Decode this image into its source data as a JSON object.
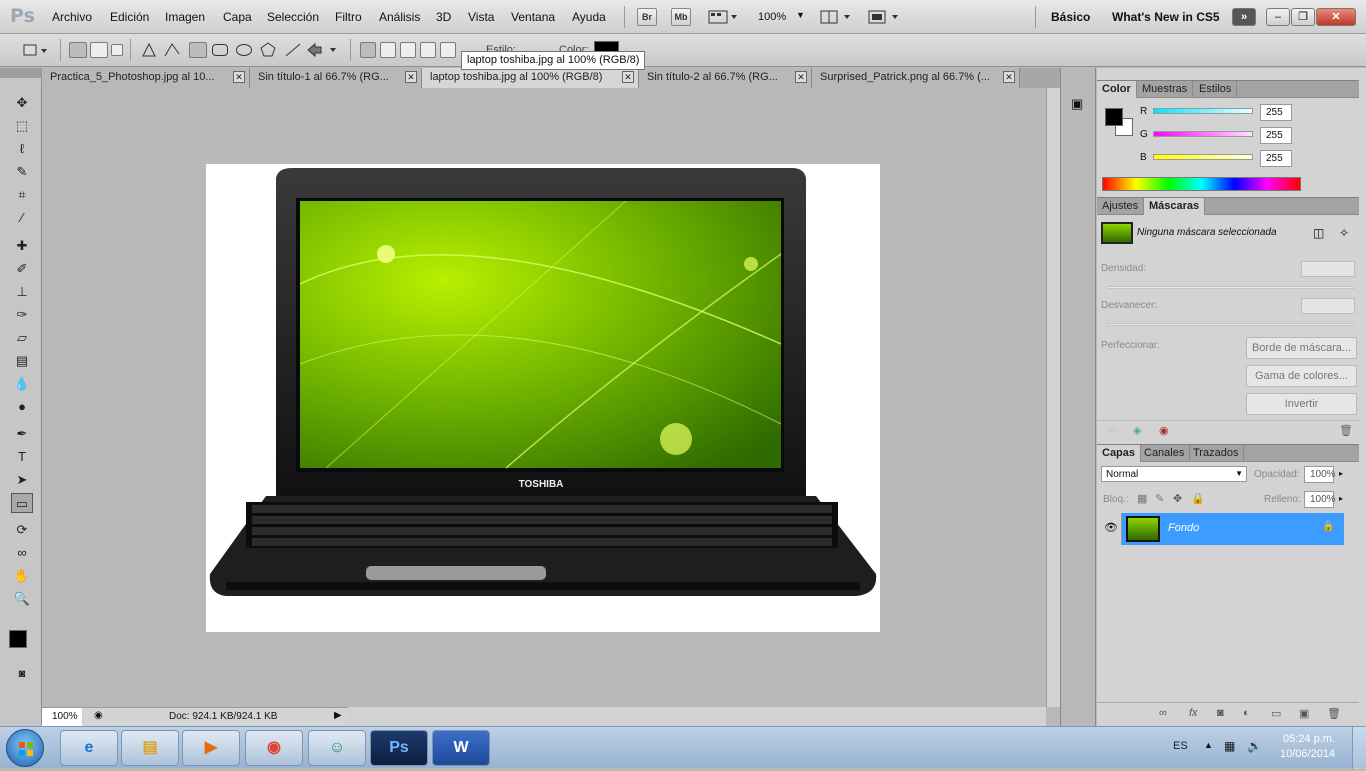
{
  "menubar": {
    "items": [
      "Archivo",
      "Edición",
      "Imagen",
      "Capa",
      "Selección",
      "Filtro",
      "Análisis",
      "3D",
      "Vista",
      "Ventana",
      "Ayuda"
    ],
    "logo": "Ps",
    "bridge_label": "Br",
    "minibridge_label": "Mb",
    "zoom": "100%",
    "workspace_basic": "Básico",
    "workspace_new": "What's New in CS5",
    "more_label": "»"
  },
  "options": {
    "style_label": "Estilo:",
    "color_label": "Color:",
    "tooltip": "laptop toshiba.jpg al 100% (RGB/8)"
  },
  "tabs": [
    {
      "label": "Practica_5_Photoshop.jpg al 10...",
      "active": false
    },
    {
      "label": "Sin título-1 al 66.7% (RG...",
      "active": false
    },
    {
      "label": "laptop toshiba.jpg al 100% (RGB/8)",
      "active": true
    },
    {
      "label": "Sin título-2 al 66.7% (RG...",
      "active": false
    },
    {
      "label": "Surprised_Patrick.png al 66.7% (...",
      "active": false
    }
  ],
  "image": {
    "brand": "TOSHIBA"
  },
  "status": {
    "zoom": "100%",
    "doc": "Doc: 924.1 KB/924.1 KB"
  },
  "color_panel": {
    "tabs": [
      "Color",
      "Muestras",
      "Estilos"
    ],
    "channels": [
      {
        "label": "R",
        "value": "255",
        "color": "#00e5ff"
      },
      {
        "label": "G",
        "value": "255",
        "color": "#ff00ff"
      },
      {
        "label": "B",
        "value": "255",
        "color": "#ffff00"
      }
    ]
  },
  "masks_panel": {
    "tabs": [
      "Ajustes",
      "Máscaras"
    ],
    "status": "Ninguna máscara seleccionada",
    "density_label": "Densidad:",
    "feather_label": "Desvanecer:",
    "refine_label": "Perfeccionar:",
    "btn_edge": "Borde de máscara...",
    "btn_range": "Gama de colores...",
    "btn_invert": "Invertir"
  },
  "layers_panel": {
    "tabs": [
      "Capas",
      "Canales",
      "Trazados"
    ],
    "blend_mode": "Normal",
    "opacity_label": "Opacidad:",
    "opacity_value": "100%",
    "lock_label": "Bloq.:",
    "fill_label": "Relleno:",
    "fill_value": "100%",
    "layer_name": "Fondo",
    "selected_color": "#3d9cff"
  },
  "taskbar": {
    "language": "ES",
    "time": "05:24 p.m.",
    "date": "10/06/2014",
    "apps": [
      "ie-icon",
      "explorer-icon",
      "media-icon",
      "chrome-icon",
      "messenger-icon",
      "photoshop-icon",
      "word-icon"
    ],
    "ps_label": "Ps",
    "word_label": "W"
  }
}
